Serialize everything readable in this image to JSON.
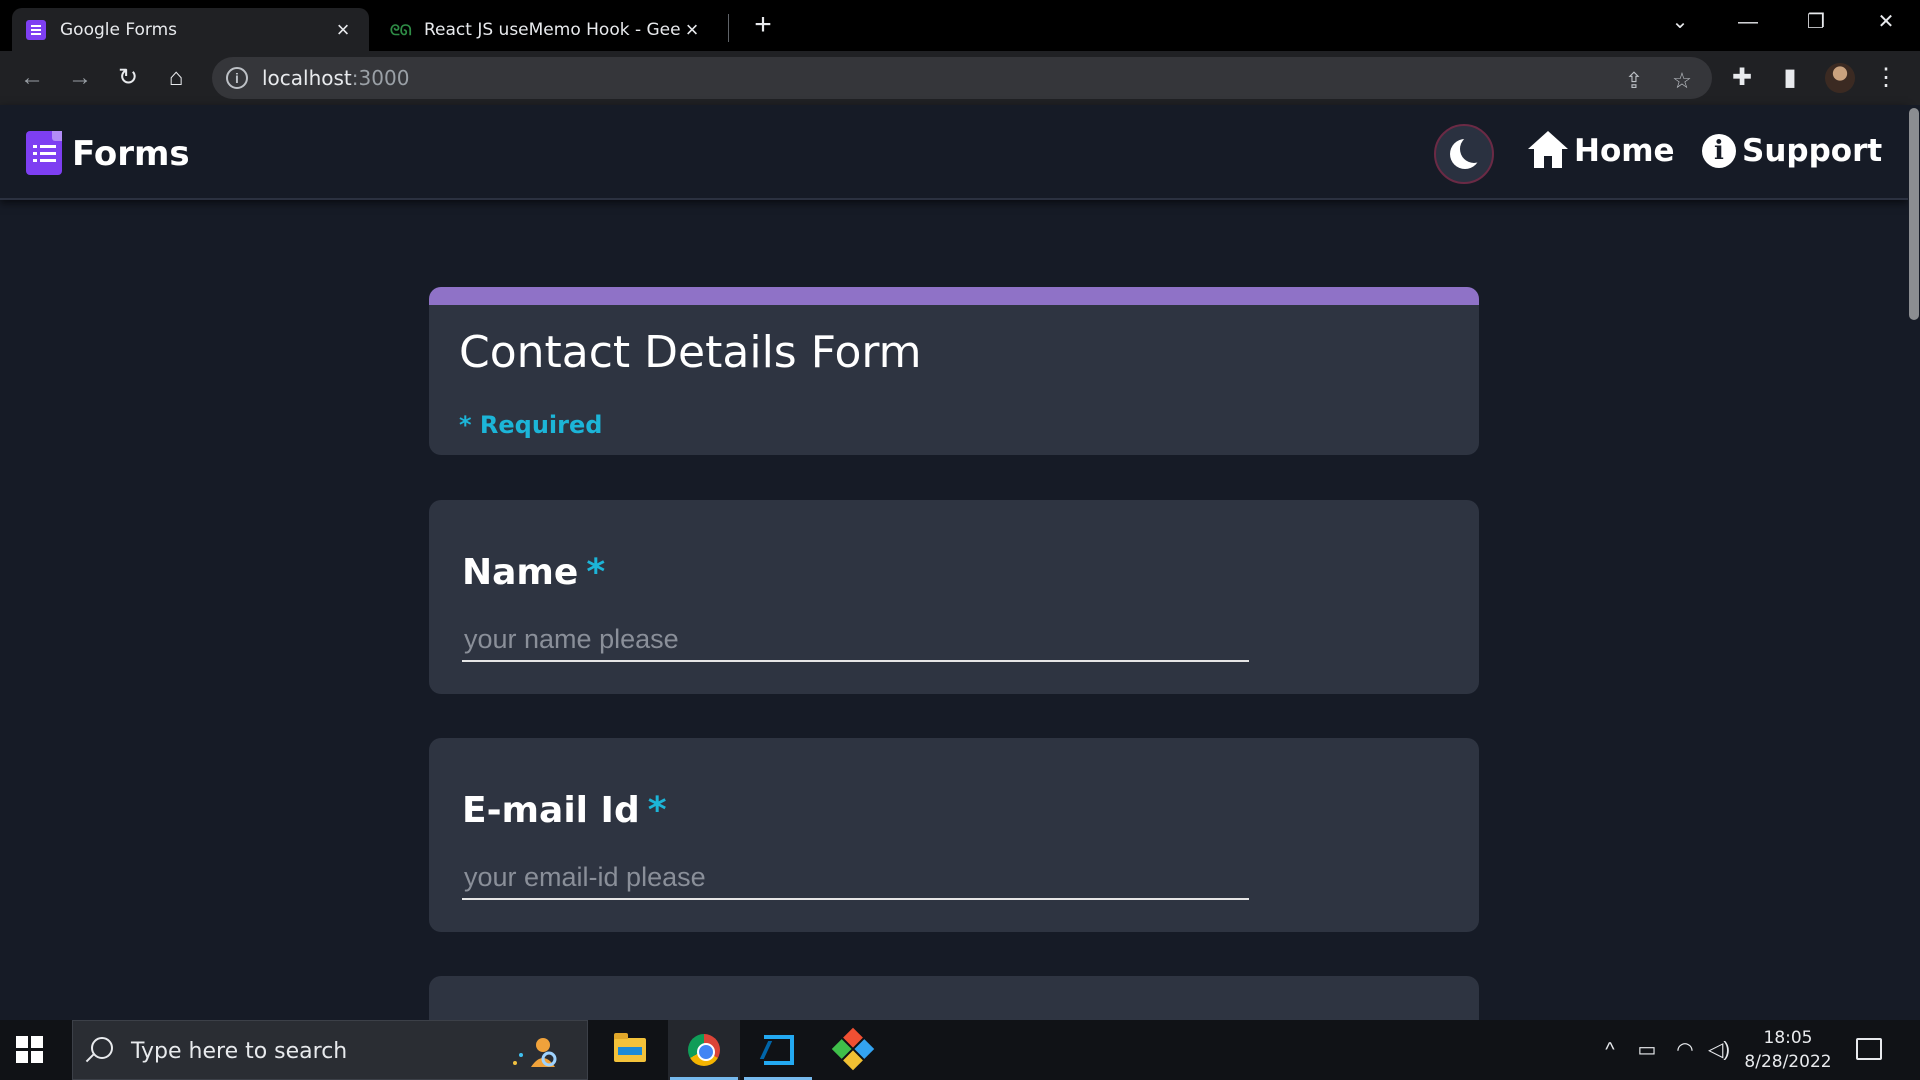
{
  "browser": {
    "tabs": [
      {
        "title": "Google Forms",
        "active": true,
        "icon": "google-forms-icon"
      },
      {
        "title": "React JS useMemo Hook - GeeksforGeeks",
        "active": false,
        "icon": "geeksforgeeks-icon"
      }
    ],
    "url_host": "localhost",
    "url_port": ":3000"
  },
  "app": {
    "brand": "Forms",
    "nav": {
      "home_label": "Home",
      "support_label": "Support"
    },
    "theme_toggle_icon": "moon-icon"
  },
  "form": {
    "title": "Contact Details Form",
    "required_note": "* Required",
    "questions": [
      {
        "label": "Name",
        "required_mark": "*",
        "placeholder": "your name please",
        "value": ""
      },
      {
        "label": "E-mail Id",
        "required_mark": "*",
        "placeholder": "your email-id please",
        "value": ""
      }
    ]
  },
  "taskbar": {
    "search_placeholder": "Type here to search",
    "time": "18:05",
    "date": "8/28/2022"
  },
  "colors": {
    "accent_purple": "#8f72c7",
    "required_cyan": "#1cb5d8",
    "card_bg": "#2e3441",
    "page_bg": "#161b26"
  }
}
